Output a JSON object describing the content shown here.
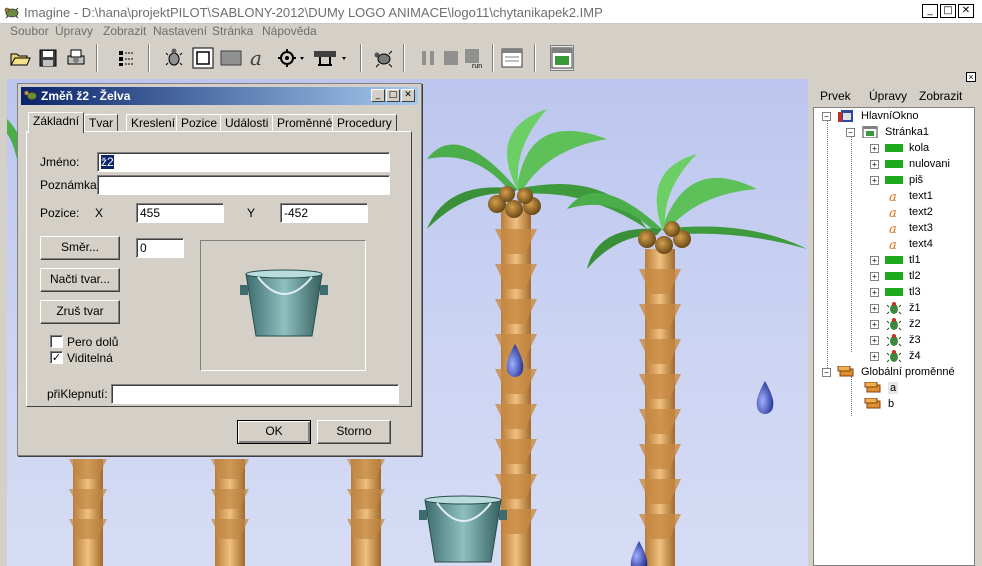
{
  "app": {
    "title": "Imagine - D:\\hana\\projektPILOT\\SABLONY-2012\\DUMy LOGO ANIMACE\\logo11\\chytanikapek2.IMP",
    "window_buttons": {
      "minimize": "_",
      "maximize": "□",
      "close": "✕"
    }
  },
  "menu": [
    "Soubor",
    "Úpravy",
    "Zobrazit",
    "Nastavení",
    "Stránka",
    "Nápověda"
  ],
  "toolbar": {
    "icons": [
      "open-icon",
      "save-icon",
      "print-icon",
      "grid-icon",
      "turtle-icon",
      "rect-icon",
      "filled-rect-icon",
      "text-a-icon",
      "gear-icon",
      "button-icon",
      "turtle-run-icon",
      "pause-icon",
      "stop-icon",
      "run-icon",
      "window-icon",
      "page-icon"
    ],
    "run_label": "run"
  },
  "dialog": {
    "title": "Změň ž2  - Želva",
    "tabs": [
      "Základní",
      "Tvar",
      "Kreslení",
      "Pozice",
      "Události",
      "Proměnné",
      "Procedury"
    ],
    "active_tab": "Základní",
    "name_label": "Jméno:",
    "name_value": "ž2",
    "note_label": "Poznámka:",
    "note_value": "",
    "position_label": "Pozice:",
    "x_label": "X",
    "x_value": "455",
    "y_label": "Y",
    "y_value": "-452",
    "direction_button": "Směr...",
    "direction_value": "0",
    "load_shape_button": "Načti tvar...",
    "clear_shape_button": "Zruš tvar",
    "pen_down_label": "Pero dolů",
    "pen_down_checked": false,
    "visible_label": "Viditelná",
    "visible_checked": true,
    "onclick_label": "přiKlepnutí:",
    "onclick_value": "",
    "ok_button": "OK",
    "cancel_button": "Storno"
  },
  "panel": {
    "close": "×",
    "menu": [
      "Prvek",
      "Úpravy",
      "Zobrazit"
    ],
    "tree": [
      {
        "label": "HlavníOkno",
        "icon": "window-icon",
        "expander": "−"
      },
      {
        "label": "Stránka1",
        "icon": "page-icon",
        "expander": "−"
      },
      {
        "label": "kola",
        "icon": "green-rect-icon",
        "expander": "+"
      },
      {
        "label": "nulovani",
        "icon": "green-rect-icon",
        "expander": "+"
      },
      {
        "label": "piš",
        "icon": "green-rect-icon",
        "expander": "+"
      },
      {
        "label": "text1",
        "icon": "text-a-icon",
        "expander": ""
      },
      {
        "label": "text2",
        "icon": "text-a-icon",
        "expander": ""
      },
      {
        "label": "text3",
        "icon": "text-a-icon",
        "expander": ""
      },
      {
        "label": "text4",
        "icon": "text-a-icon",
        "expander": ""
      },
      {
        "label": "tl1",
        "icon": "green-rect-icon",
        "expander": "+"
      },
      {
        "label": "tl2",
        "icon": "green-rect-icon",
        "expander": "+"
      },
      {
        "label": "tl3",
        "icon": "green-rect-icon",
        "expander": "+"
      },
      {
        "label": "ž1",
        "icon": "turtle-icon",
        "expander": "+"
      },
      {
        "label": "ž2",
        "icon": "turtle-icon",
        "expander": "+"
      },
      {
        "label": "ž3",
        "icon": "turtle-icon",
        "expander": "+"
      },
      {
        "label": "ž4",
        "icon": "turtle-icon",
        "expander": "+"
      },
      {
        "label": "Globální proměnné",
        "icon": "variable-icon",
        "expander": "−"
      },
      {
        "label": "a",
        "icon": "variable-icon",
        "expander": ""
      },
      {
        "label": "b",
        "icon": "variable-icon",
        "expander": ""
      }
    ]
  },
  "colors": {
    "sky": "#c9d2f2",
    "palm_leaf": "#4cae4a",
    "trunk": "#d49a52",
    "drop": "#2b3da0",
    "bucket": "#4f8a8c",
    "title_active": "#0a246a"
  }
}
